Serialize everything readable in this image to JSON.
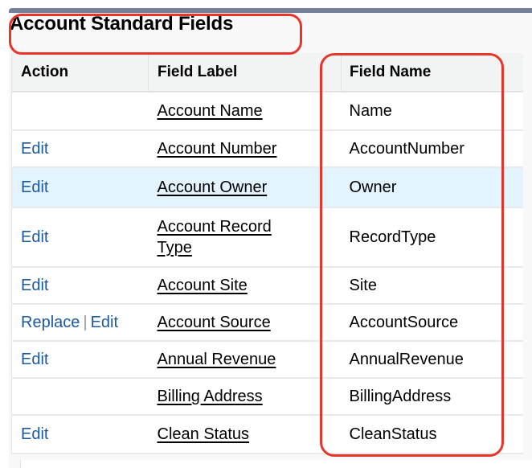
{
  "panel": {
    "title": "Account Standard Fields",
    "accent_color": "#747f99"
  },
  "table": {
    "columns": [
      "Action",
      "Field Label",
      "Field Name"
    ],
    "rows": [
      {
        "actions": [],
        "label": "Account Name",
        "name": "Name",
        "highlighted": false
      },
      {
        "actions": [
          "Edit"
        ],
        "label": "Account Number",
        "name": "AccountNumber",
        "highlighted": false
      },
      {
        "actions": [
          "Edit"
        ],
        "label": "Account Owner",
        "name": "Owner",
        "highlighted": true
      },
      {
        "actions": [
          "Edit"
        ],
        "label": "Account Record Type",
        "name": "RecordType",
        "highlighted": false
      },
      {
        "actions": [
          "Edit"
        ],
        "label": "Account Site",
        "name": "Site",
        "highlighted": false
      },
      {
        "actions": [
          "Replace",
          "Edit"
        ],
        "label": "Account Source",
        "name": "AccountSource",
        "highlighted": false
      },
      {
        "actions": [
          "Edit"
        ],
        "label": "Annual Revenue",
        "name": "AnnualRevenue",
        "highlighted": false
      },
      {
        "actions": [],
        "label": "Billing Address",
        "name": "BillingAddress",
        "highlighted": false
      },
      {
        "actions": [
          "Edit"
        ],
        "label": "Clean Status",
        "name": "CleanStatus",
        "highlighted": false
      }
    ],
    "action_separator": "|"
  },
  "annotations": {
    "color": "#e8352a",
    "targets": [
      "panel-title",
      "field-name-column"
    ]
  }
}
